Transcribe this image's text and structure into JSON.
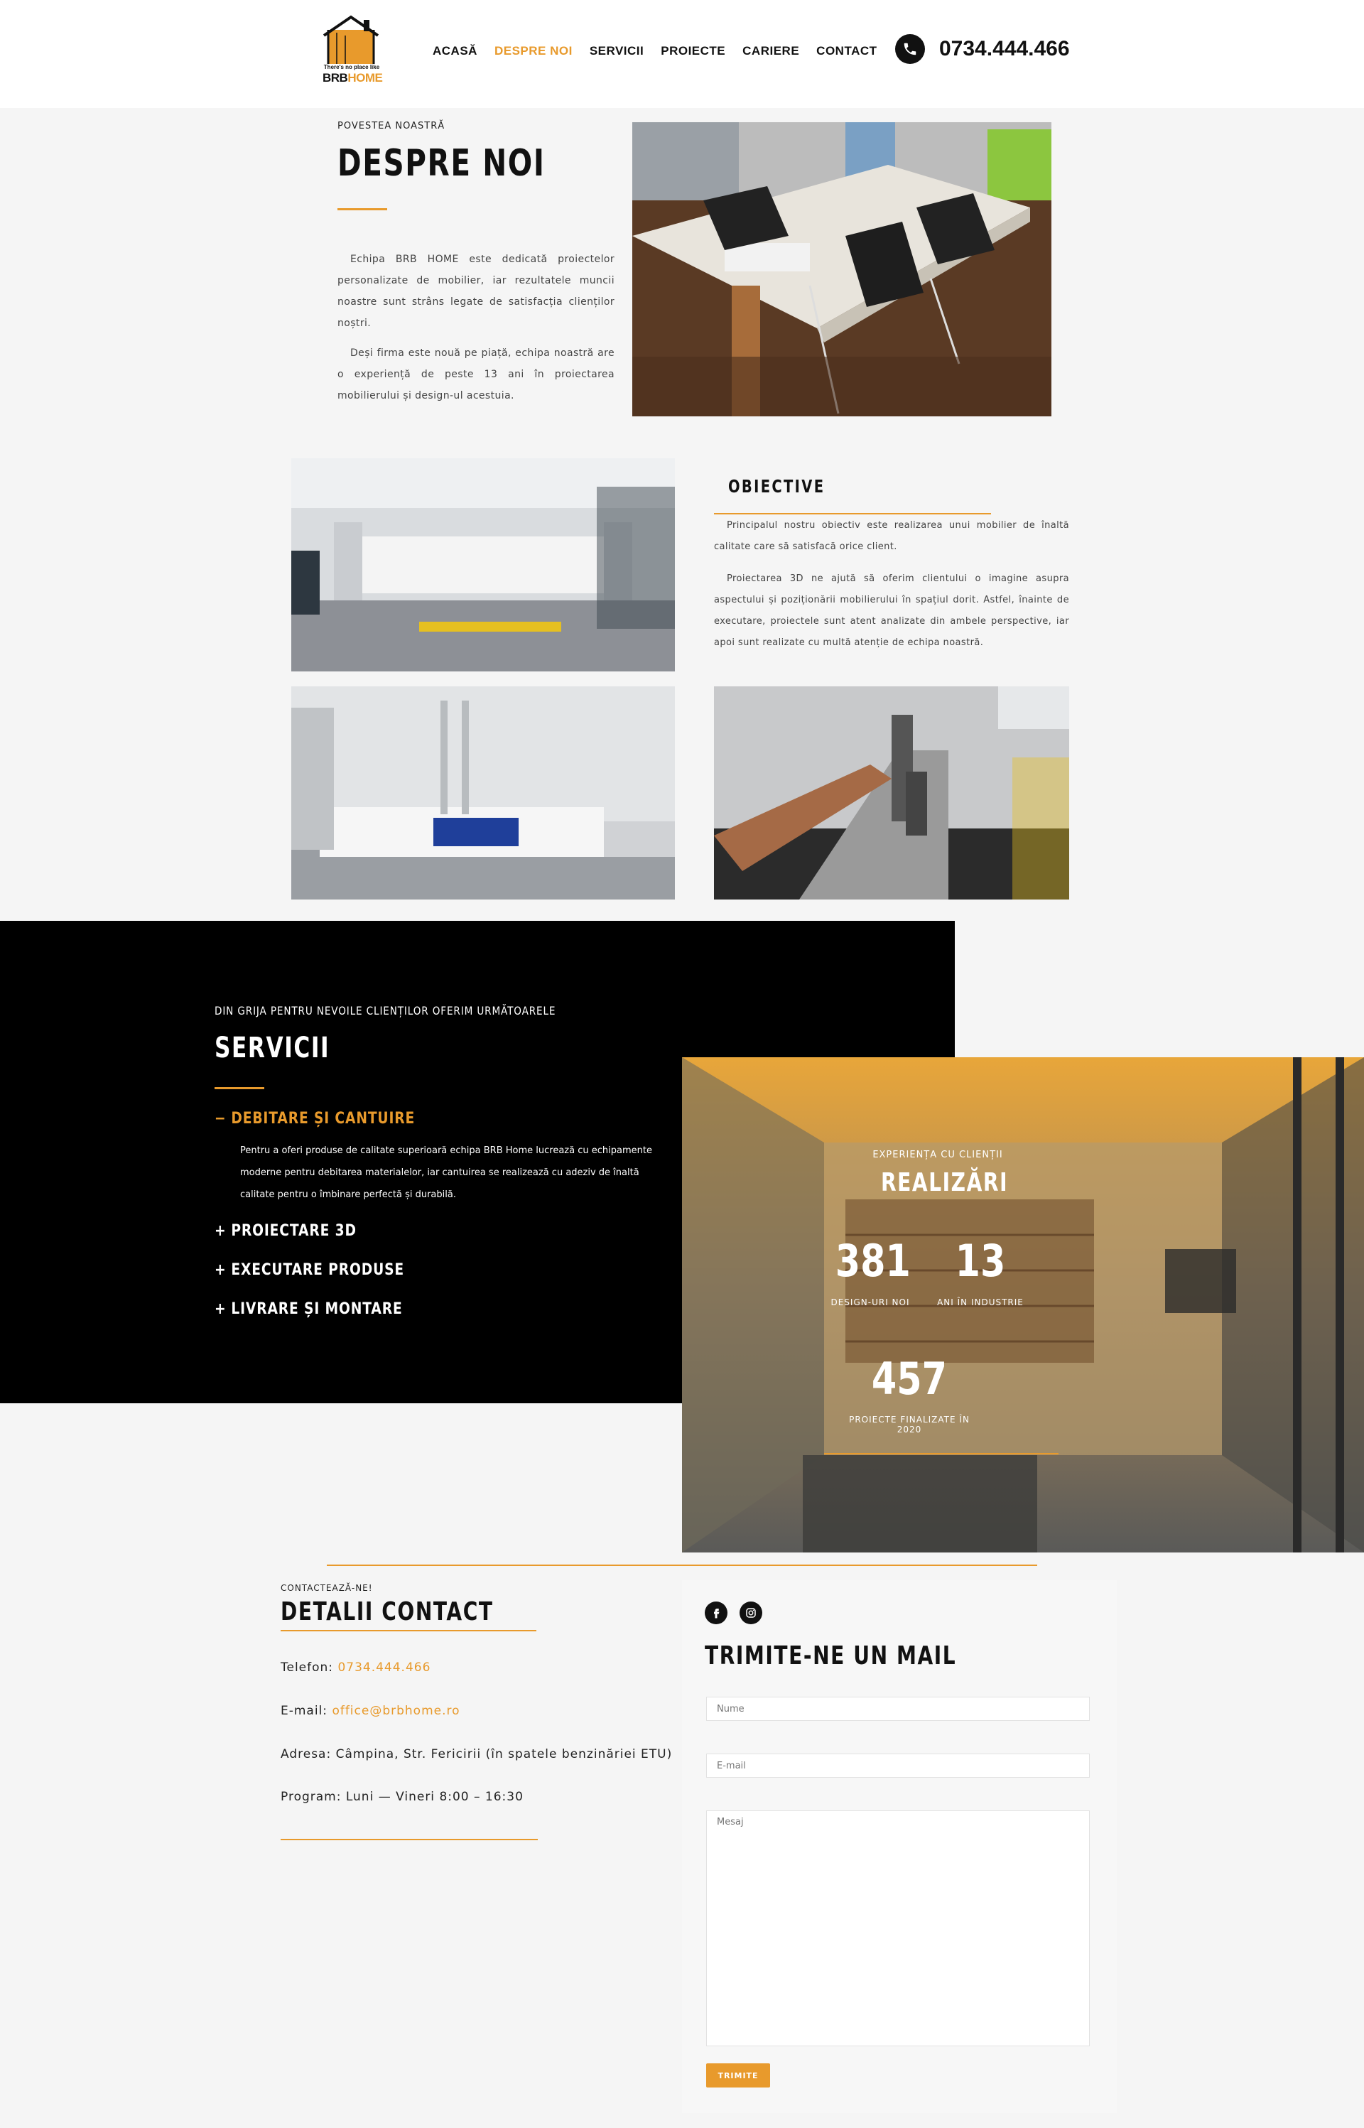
{
  "header": {
    "logo_tagline": "There's no place like",
    "logo_brand_a": "BRB",
    "logo_brand_b": "HOME",
    "nav": [
      {
        "label": "ACASĂ",
        "active": false
      },
      {
        "label": "DESPRE NOI",
        "active": true
      },
      {
        "label": "SERVICII",
        "active": false
      },
      {
        "label": "PROIECTE",
        "active": false
      },
      {
        "label": "CARIERE",
        "active": false
      },
      {
        "label": "CONTACT",
        "active": false
      }
    ],
    "phone": "0734.444.466"
  },
  "about": {
    "eyebrow": "POVESTEA NOASTRĂ",
    "title": "DESPRE NOI",
    "p1": "Echipa BRB HOME este dedicată proiectelor personalizate de mobilier, iar rezultatele muncii noastre sunt strâns legate de satisfacția clienților noștri.",
    "p2": "Deși firma este nouă pe piață, echipa noastră are o experiență de peste 13 ani în proiectarea mobilierului și design-ul acestuia."
  },
  "objectives": {
    "title": "OBIECTIVE",
    "p1": "Principalul nostru obiectiv este realizarea unui mobilier de înaltă calitate care să satisfacă orice client.",
    "p2": "Proiectarea 3D ne ajută să oferim clientului o imagine asupra aspectului și poziționării mobilierului în spațiul dorit. Astfel, înainte de executare, proiectele sunt atent analizate din ambele perspective, iar apoi sunt realizate cu multă atenție de echipa noastră."
  },
  "services": {
    "eyebrow": "DIN GRIJA PENTRU NEVOILE CLIENȚILOR OFERIM URMĂTOARELE",
    "title": "SERVICII",
    "open_item": {
      "sign": "−",
      "label": "DEBITARE ȘI CANTUIRE",
      "text": "Pentru a oferi produse de calitate superioară echipa BRB Home lucrează cu echipamente moderne pentru debitarea materialelor, iar cantuirea se realizează cu adeziv de înaltă calitate pentru o îmbinare perfectă și durabilă."
    },
    "items": [
      {
        "sign": "+",
        "label": "PROIECTARE 3D"
      },
      {
        "sign": "+",
        "label": "EXECUTARE PRODUSE"
      },
      {
        "sign": "+",
        "label": "LIVRARE ȘI MONTARE"
      }
    ]
  },
  "achievements": {
    "eyebrow": "EXPERIENȚA CU CLIENȚII",
    "title": "REALIZĂRI",
    "stats": [
      {
        "value": "381",
        "label": "DESIGN-URI NOI"
      },
      {
        "value": "13",
        "label": "ANI ÎN INDUSTRIE"
      },
      {
        "value": "457",
        "label": "PROIECTE FINALIZATE ÎN 2020"
      }
    ]
  },
  "contact": {
    "eyebrow": "CONTACTEAZĂ-NE!",
    "title": "DETALII CONTACT",
    "phone_label": "Telefon:",
    "phone_value": "0734.444.466",
    "email_label": "E-mail:",
    "email_value": "office@brbhome.ro",
    "address": "Adresa: Câmpina, Str. Fericirii (în spatele benzinăriei ETU)",
    "program": "Program: Luni — Vineri 8:00 – 16:30"
  },
  "form": {
    "title": "TRIMITE-NE UN MAIL",
    "name_placeholder": "Nume",
    "email_placeholder": "E-mail",
    "message_placeholder": "Mesaj",
    "submit": "TRIMITE"
  },
  "colors": {
    "accent": "#e89a2c",
    "dark": "#000000",
    "page": "#f5f5f5"
  }
}
